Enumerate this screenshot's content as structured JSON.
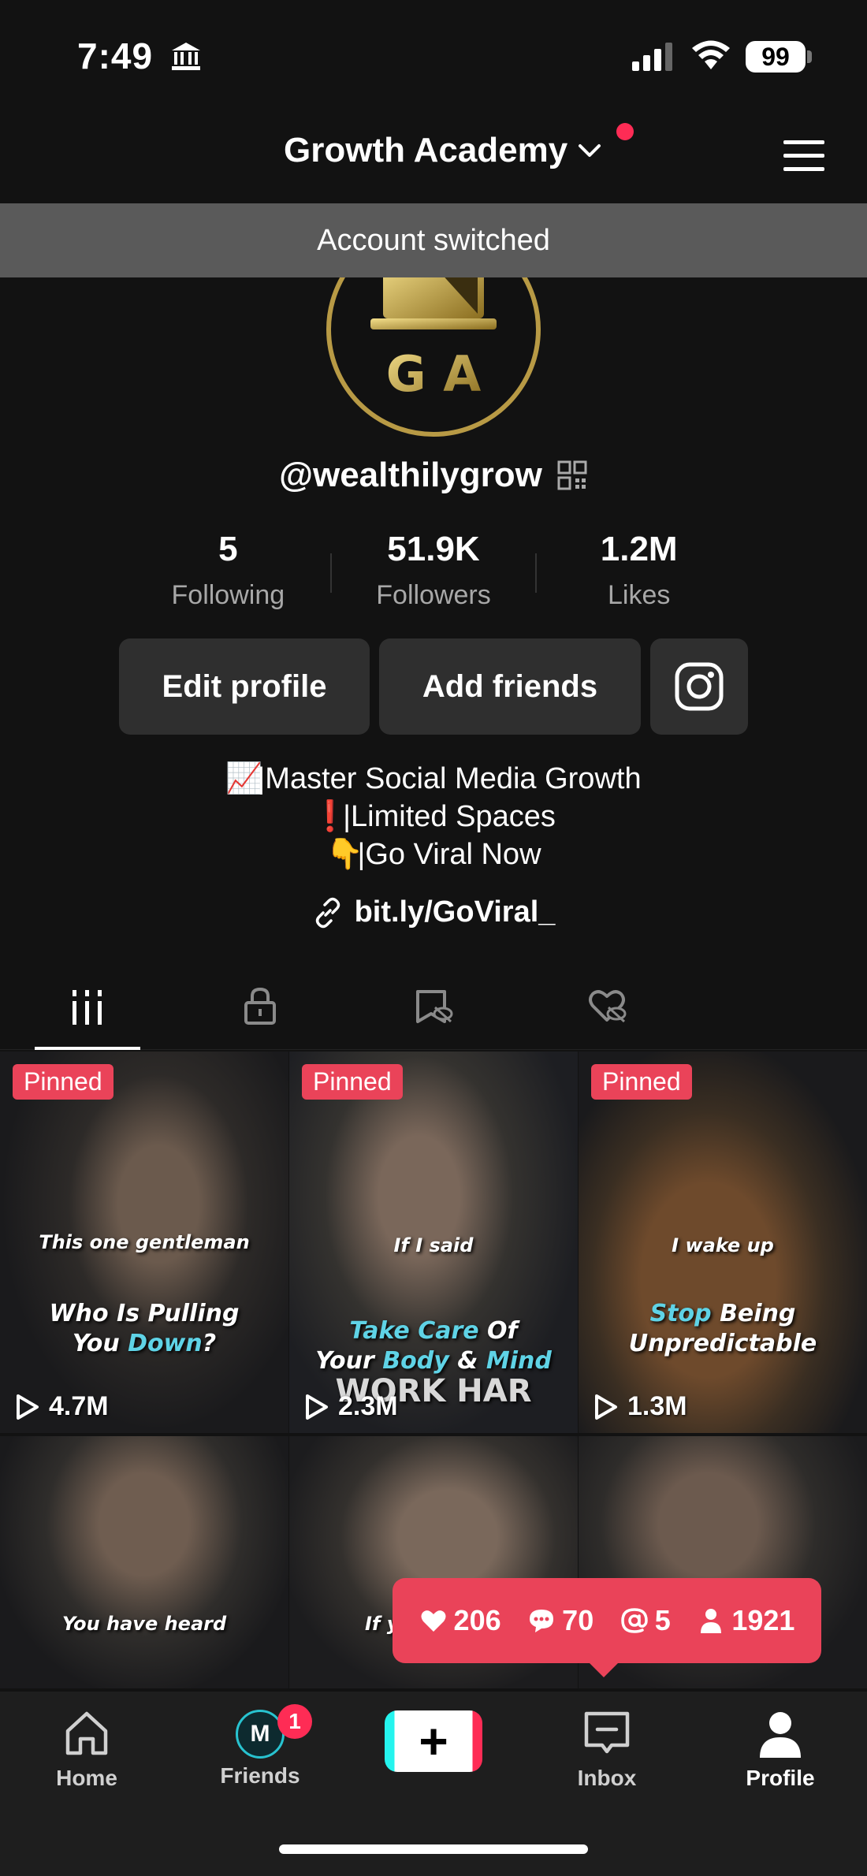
{
  "status_bar": {
    "time": "7:49",
    "battery": "99"
  },
  "header": {
    "account_name": "Growth Academy"
  },
  "toast": {
    "text": "Account switched"
  },
  "profile": {
    "avatar_text": "G A",
    "username": "@wealthilygrow",
    "stats": [
      {
        "value": "5",
        "label": "Following"
      },
      {
        "value": "51.9K",
        "label": "Followers"
      },
      {
        "value": "1.2M",
        "label": "Likes"
      }
    ],
    "buttons": {
      "edit": "Edit profile",
      "add_friends": "Add friends"
    },
    "bio": [
      {
        "emoji": "📈",
        "text": "|Master Social Media Growth"
      },
      {
        "emoji": "❗",
        "text": "|Limited Spaces"
      },
      {
        "emoji": "👇",
        "text": "|Go Viral Now"
      }
    ],
    "link": "bit.ly/GoViral_"
  },
  "tabs": [
    "videos-grid-icon",
    "lock-icon",
    "saved-hidden-icon",
    "liked-hidden-icon"
  ],
  "videos": [
    {
      "pinned": "Pinned",
      "caption_top": "This one gentleman",
      "caption_main": "Who Is Pulling",
      "caption_main2a": "You ",
      "caption_accent": "Down",
      "caption_main2b": "?",
      "views": "4.7M"
    },
    {
      "pinned": "Pinned",
      "caption_top": "If I said",
      "caption_accent": "Take Care",
      "caption_main": " Of",
      "caption_main2a": "Your ",
      "caption_accent2": "Body",
      "caption_main2b": " & ",
      "caption_accent3": "Mind",
      "shirt_text": "WORK HAR",
      "views": "2.3M"
    },
    {
      "pinned": "Pinned",
      "caption_top": "I wake up",
      "caption_accent": "Stop",
      "caption_main": " Being",
      "caption_main2a": "Unpredictable",
      "views": "1.3M"
    },
    {
      "caption_top": "You have heard"
    },
    {
      "caption_top": "If you"
    },
    {
      "caption_top": ""
    }
  ],
  "activity": {
    "likes": "206",
    "comments": "70",
    "mentions": "5",
    "followers": "1921"
  },
  "nav": {
    "home": "Home",
    "friends": "Friends",
    "friends_badge": "1",
    "friends_avatar": "M",
    "create": "+",
    "inbox": "Inbox",
    "profile": "Profile"
  },
  "colors": {
    "accent_red": "#ea4359",
    "caption_cyan": "#5fd3e6",
    "gold": "#b89a45",
    "tiktok_cyan": "#25f4ee",
    "tiktok_pink": "#fe2c55"
  }
}
